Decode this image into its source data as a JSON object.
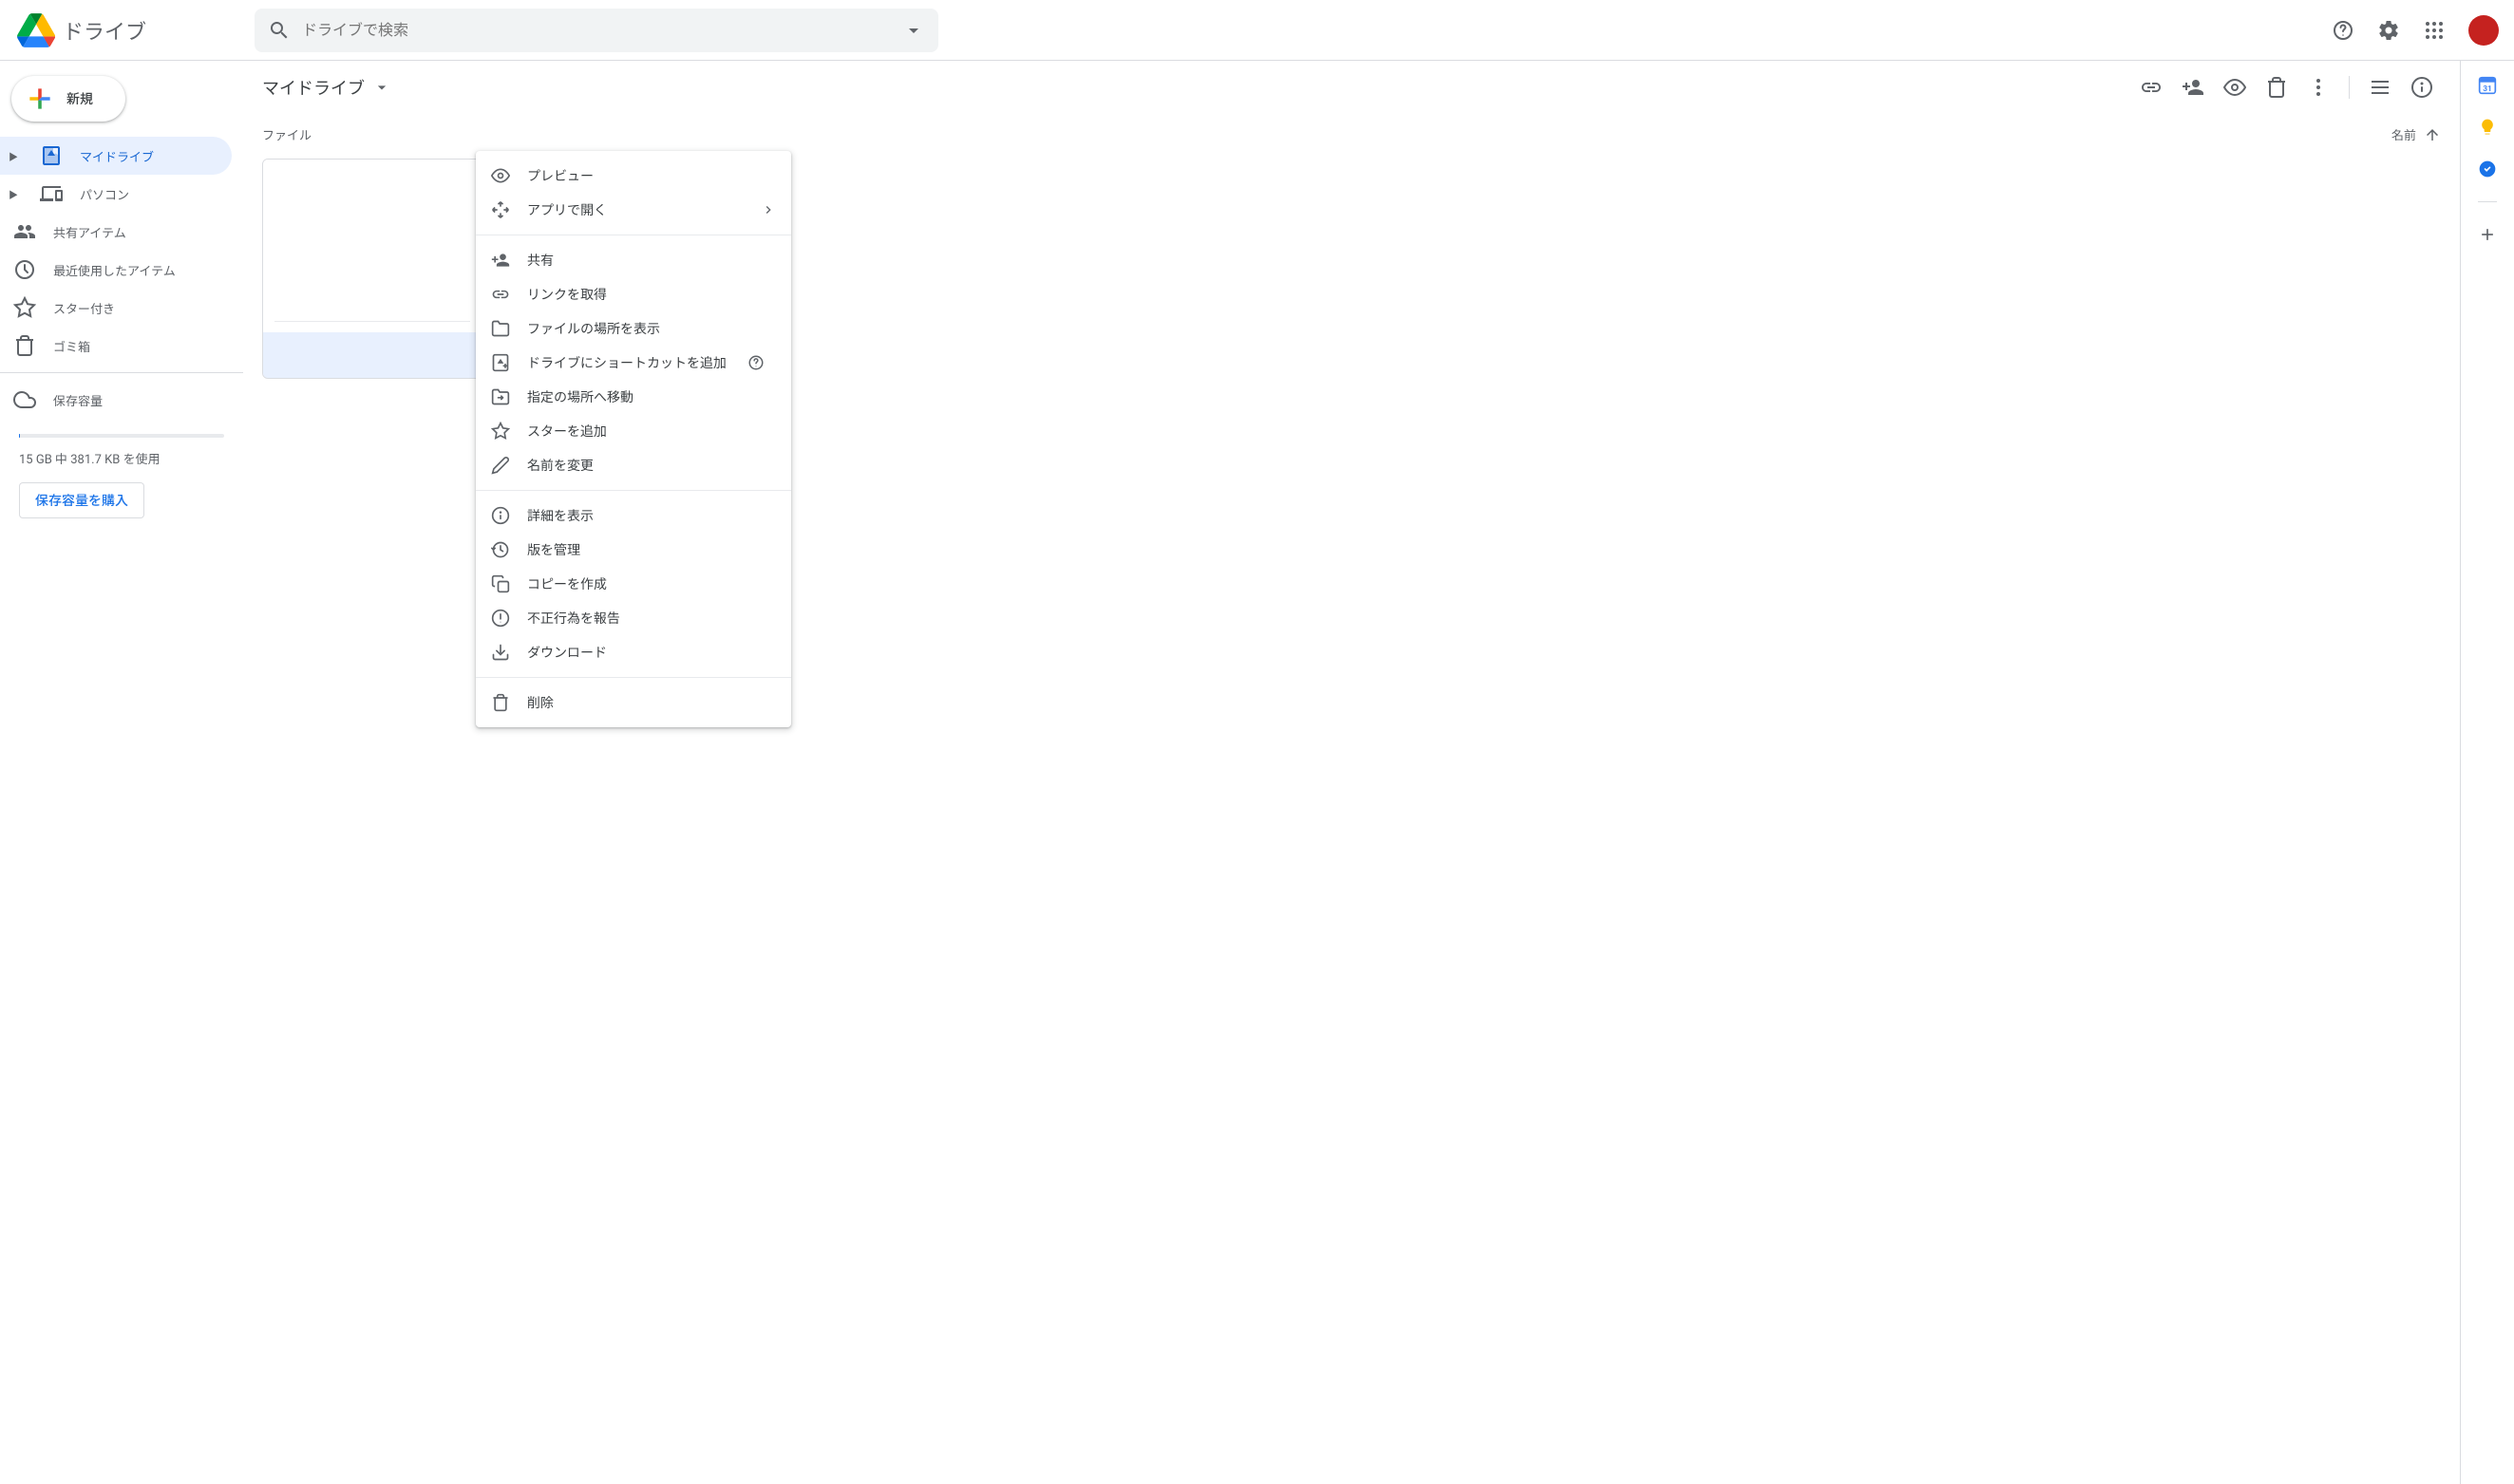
{
  "header": {
    "app_title": "ドライブ",
    "search_placeholder": "ドライブで検索"
  },
  "sidebar": {
    "new_label": "新規",
    "items": [
      {
        "label": "マイドライブ"
      },
      {
        "label": "パソコン"
      },
      {
        "label": "共有アイテム"
      },
      {
        "label": "最近使用したアイテム"
      },
      {
        "label": "スター付き"
      },
      {
        "label": "ゴミ箱"
      }
    ],
    "storage_label": "保存容量",
    "storage_text": "15 GB 中 381.7 KB を使用",
    "buy_label": "保存容量を購入"
  },
  "toolbar": {
    "breadcrumb": "マイドライブ"
  },
  "content": {
    "section_title": "ファイル",
    "sort_label": "名前"
  },
  "context_menu": {
    "items": [
      {
        "label": "プレビュー"
      },
      {
        "label": "アプリで開く"
      },
      {
        "label": "共有"
      },
      {
        "label": "リンクを取得"
      },
      {
        "label": "ファイルの場所を表示"
      },
      {
        "label": "ドライブにショートカットを追加"
      },
      {
        "label": "指定の場所へ移動"
      },
      {
        "label": "スターを追加"
      },
      {
        "label": "名前を変更"
      },
      {
        "label": "詳細を表示"
      },
      {
        "label": "版を管理"
      },
      {
        "label": "コピーを作成"
      },
      {
        "label": "不正行為を報告"
      },
      {
        "label": "ダウンロード"
      },
      {
        "label": "削除"
      }
    ]
  }
}
